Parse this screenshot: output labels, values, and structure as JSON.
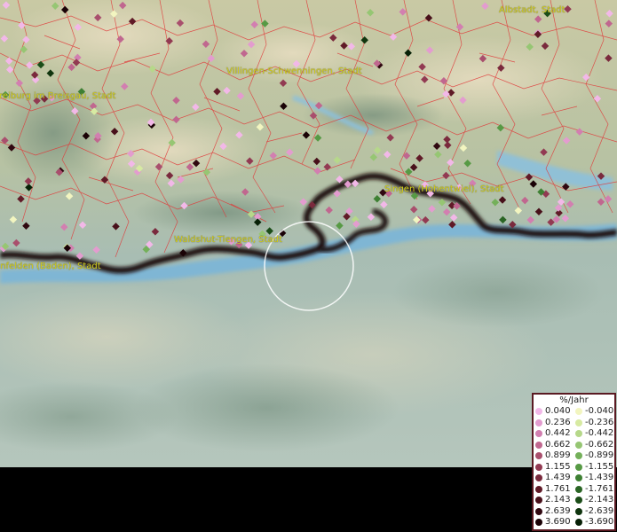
{
  "map": {
    "cities": [
      {
        "name": "Albstadt, Stadt"
      },
      {
        "name": "Villingen-Schwenningen, Stadt"
      },
      {
        "name": "Freiburg im Breisgau, Stadt"
      },
      {
        "name": "Singen (Hohentwiel), Stadt"
      },
      {
        "name": "Waldshut-Tiengen, Stadt"
      },
      {
        "name": "Rheinfelden (Baden), Stadt"
      }
    ],
    "cursor": "selection-circle"
  },
  "legend": {
    "title": "%/Jahr",
    "positive": [
      {
        "value": "0.040",
        "color": "#f2b8e8"
      },
      {
        "value": "0.236",
        "color": "#e39ccf"
      },
      {
        "value": "0.442",
        "color": "#d27fb0"
      },
      {
        "value": "0.662",
        "color": "#c0678f"
      },
      {
        "value": "0.899",
        "color": "#a94f6d"
      },
      {
        "value": "1.155",
        "color": "#923a52"
      },
      {
        "value": "1.439",
        "color": "#7a2a3d"
      },
      {
        "value": "1.761",
        "color": "#601a27"
      },
      {
        "value": "2.143",
        "color": "#48101a"
      },
      {
        "value": "2.639",
        "color": "#300810"
      },
      {
        "value": "3.690",
        "color": "#1a0206"
      }
    ],
    "negative": [
      {
        "value": "-0.040",
        "color": "#f2f5c0"
      },
      {
        "value": "-0.236",
        "color": "#d7eaa2"
      },
      {
        "value": "-0.442",
        "color": "#b6d88a"
      },
      {
        "value": "-0.662",
        "color": "#96c673"
      },
      {
        "value": "-0.899",
        "color": "#74b05a"
      },
      {
        "value": "-1.155",
        "color": "#579a45"
      },
      {
        "value": "-1.439",
        "color": "#3e8033"
      },
      {
        "value": "-1.761",
        "color": "#2a6524"
      },
      {
        "value": "-2.143",
        "color": "#1b4d18"
      },
      {
        "value": "-2.639",
        "color": "#10350e"
      },
      {
        "value": "-3.690",
        "color": "#072006"
      }
    ]
  }
}
